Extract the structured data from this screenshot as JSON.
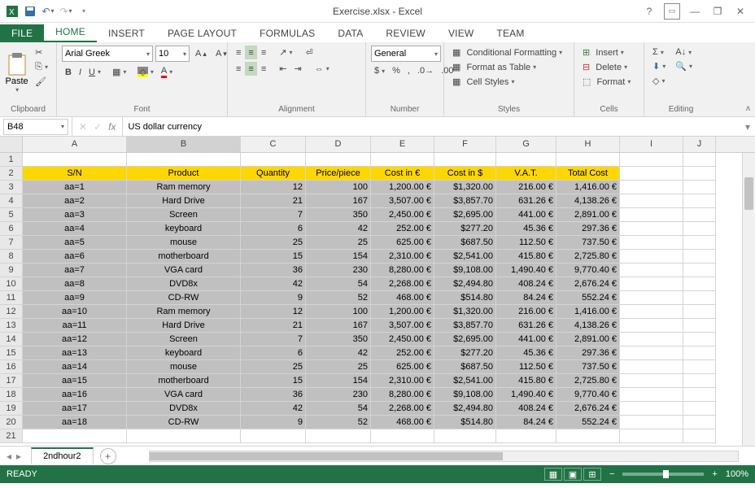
{
  "app": {
    "title": "Exercise.xlsx - Excel"
  },
  "tabs": [
    "FILE",
    "HOME",
    "INSERT",
    "PAGE LAYOUT",
    "FORMULAS",
    "DATA",
    "REVIEW",
    "VIEW",
    "Team"
  ],
  "active_tab": "HOME",
  "ribbon": {
    "clipboard": {
      "label": "Clipboard",
      "paste": "Paste"
    },
    "font": {
      "label": "Font",
      "name": "Arial Greek",
      "size": "10"
    },
    "alignment": {
      "label": "Alignment"
    },
    "number": {
      "label": "Number",
      "format": "General"
    },
    "styles": {
      "label": "Styles",
      "cond": "Conditional Formatting",
      "table": "Format as Table",
      "cell": "Cell Styles"
    },
    "cells": {
      "label": "Cells",
      "insert": "Insert",
      "delete": "Delete",
      "format": "Format"
    },
    "editing": {
      "label": "Editing"
    }
  },
  "name_box": "B48",
  "formula_value": "US dollar currency",
  "columns": [
    "A",
    "B",
    "C",
    "D",
    "E",
    "F",
    "G",
    "H",
    "I",
    "J"
  ],
  "headers": [
    "S/N",
    "Product",
    "Quantity",
    "Price/piece",
    "Cost in €",
    "Cost in $",
    "V.A.T.",
    "Total Cost"
  ],
  "rows": [
    {
      "n": 1
    },
    {
      "n": 2,
      "hdr": true
    },
    {
      "n": 3,
      "d": [
        "aa=1",
        "Ram memory",
        "12",
        "100",
        "1,200.00 €",
        "$1,320.00",
        "216.00 €",
        "1,416.00 €"
      ]
    },
    {
      "n": 4,
      "d": [
        "aa=2",
        "Hard Drive",
        "21",
        "167",
        "3,507.00 €",
        "$3,857.70",
        "631.26 €",
        "4,138.26 €"
      ]
    },
    {
      "n": 5,
      "d": [
        "aa=3",
        "Screen",
        "7",
        "350",
        "2,450.00 €",
        "$2,695.00",
        "441.00 €",
        "2,891.00 €"
      ]
    },
    {
      "n": 6,
      "d": [
        "aa=4",
        "keyboard",
        "6",
        "42",
        "252.00 €",
        "$277.20",
        "45.36 €",
        "297.36 €"
      ]
    },
    {
      "n": 7,
      "d": [
        "aa=5",
        "mouse",
        "25",
        "25",
        "625.00 €",
        "$687.50",
        "112.50 €",
        "737.50 €"
      ]
    },
    {
      "n": 8,
      "d": [
        "aa=6",
        "motherboard",
        "15",
        "154",
        "2,310.00 €",
        "$2,541.00",
        "415.80 €",
        "2,725.80 €"
      ]
    },
    {
      "n": 9,
      "d": [
        "aa=7",
        "VGA card",
        "36",
        "230",
        "8,280.00 €",
        "$9,108.00",
        "1,490.40 €",
        "9,770.40 €"
      ]
    },
    {
      "n": 10,
      "d": [
        "aa=8",
        "DVD8x",
        "42",
        "54",
        "2,268.00 €",
        "$2,494.80",
        "408.24 €",
        "2,676.24 €"
      ]
    },
    {
      "n": 11,
      "d": [
        "aa=9",
        "CD-RW",
        "9",
        "52",
        "468.00 €",
        "$514.80",
        "84.24 €",
        "552.24 €"
      ]
    },
    {
      "n": 12,
      "d": [
        "aa=10",
        "Ram memory",
        "12",
        "100",
        "1,200.00 €",
        "$1,320.00",
        "216.00 €",
        "1,416.00 €"
      ]
    },
    {
      "n": 13,
      "d": [
        "aa=11",
        "Hard Drive",
        "21",
        "167",
        "3,507.00 €",
        "$3,857.70",
        "631.26 €",
        "4,138.26 €"
      ]
    },
    {
      "n": 14,
      "d": [
        "aa=12",
        "Screen",
        "7",
        "350",
        "2,450.00 €",
        "$2,695.00",
        "441.00 €",
        "2,891.00 €"
      ]
    },
    {
      "n": 15,
      "d": [
        "aa=13",
        "keyboard",
        "6",
        "42",
        "252.00 €",
        "$277.20",
        "45.36 €",
        "297.36 €"
      ]
    },
    {
      "n": 16,
      "d": [
        "aa=14",
        "mouse",
        "25",
        "25",
        "625.00 €",
        "$687.50",
        "112.50 €",
        "737.50 €"
      ]
    },
    {
      "n": 17,
      "d": [
        "aa=15",
        "motherboard",
        "15",
        "154",
        "2,310.00 €",
        "$2,541.00",
        "415.80 €",
        "2,725.80 €"
      ]
    },
    {
      "n": 18,
      "d": [
        "aa=16",
        "VGA card",
        "36",
        "230",
        "8,280.00 €",
        "$9,108.00",
        "1,490.40 €",
        "9,770.40 €"
      ]
    },
    {
      "n": 19,
      "d": [
        "aa=17",
        "DVD8x",
        "42",
        "54",
        "2,268.00 €",
        "$2,494.80",
        "408.24 €",
        "2,676.24 €"
      ]
    },
    {
      "n": 20,
      "d": [
        "aa=18",
        "CD-RW",
        "9",
        "52",
        "468.00 €",
        "$514.80",
        "84.24 €",
        "552.24 €"
      ]
    },
    {
      "n": 21,
      "partial": true
    }
  ],
  "sheet": {
    "name": "2ndhour2"
  },
  "status": {
    "ready": "READY",
    "zoom": "100%"
  }
}
